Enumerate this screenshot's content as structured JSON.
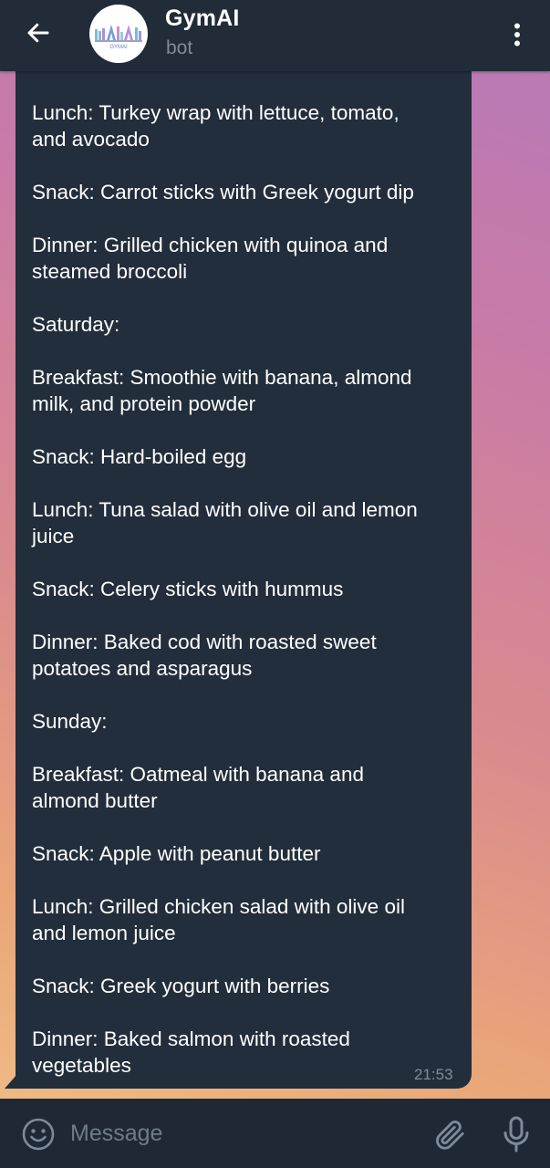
{
  "header": {
    "title": "GymAI",
    "subtitle": "bot",
    "avatar_text": "GYMAI"
  },
  "message": {
    "lines": [
      "Lunch: Turkey wrap with lettuce, tomato,",
      "and avocado",
      "Snack: Carrot sticks with Greek yogurt dip",
      "Dinner: Grilled chicken with quinoa and",
      "steamed broccoli",
      "Saturday:",
      "Breakfast: Smoothie with banana, almond",
      "milk, and protein powder",
      "Snack: Hard-boiled egg",
      "Lunch: Tuna salad with olive oil and lemon",
      "juice",
      "Snack: Celery sticks with hummus",
      "Dinner: Baked cod with roasted sweet",
      "potatoes and asparagus",
      "Sunday:",
      "Breakfast: Oatmeal with banana and",
      "almond butter",
      "Snack: Apple with peanut butter",
      "Lunch: Grilled chicken salad with olive oil",
      "and lemon juice",
      "Snack: Greek yogurt with berries",
      "Dinner: Baked salmon with roasted",
      "vegetables"
    ],
    "time": "21:53"
  },
  "input": {
    "placeholder": "Message"
  },
  "colors": {
    "header_bg": "#222c38",
    "bubble_bg": "#232e3c",
    "input_bg": "#1f2935",
    "muted_text": "#7d8b99"
  }
}
